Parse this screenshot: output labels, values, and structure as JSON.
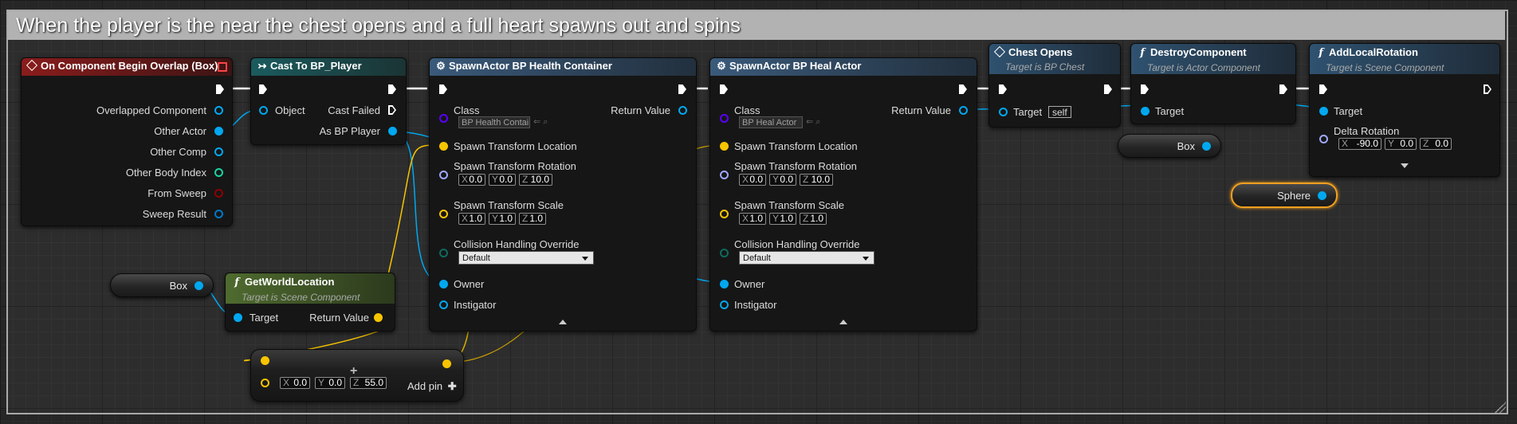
{
  "comment": {
    "title": "When the player is the near the chest opens and a full heart spawns out and spins"
  },
  "colors": {
    "exec": "#ffffff",
    "object": "#00a8f0",
    "struct": "#f7c400",
    "rotator": "#9fa8ff",
    "class": "#5a00ff",
    "boolean": "#8d0000",
    "hitresult": "#00a8f0",
    "enum": "#0e6b5f",
    "selection": "#f2a020"
  },
  "nodes": {
    "overlap": {
      "title": "On Component Begin Overlap (Box)",
      "pins": [
        "Overlapped Component",
        "Other Actor",
        "Other Comp",
        "Other Body Index",
        "From Sweep",
        "Sweep Result"
      ]
    },
    "cast": {
      "title": "Cast To BP_Player",
      "object_label": "Object",
      "cast_failed_label": "Cast Failed",
      "as_player_label": "As BP Player"
    },
    "spawn_health": {
      "title": "SpawnActor BP Health Container",
      "class_label": "Class",
      "class_value": "BP Health Contai",
      "return_label": "Return Value",
      "location_label": "Spawn Transform Location",
      "rotation_label": "Spawn Transform Rotation",
      "rotation": {
        "x": "0.0",
        "y": "0.0",
        "z": "10.0"
      },
      "scale_label": "Spawn Transform Scale",
      "scale": {
        "x": "1.0",
        "y": "1.0",
        "z": "1.0"
      },
      "collision_label": "Collision Handling Override",
      "collision_value": "Default",
      "owner_label": "Owner",
      "instigator_label": "Instigator"
    },
    "spawn_heal": {
      "title": "SpawnActor BP Heal Actor",
      "class_label": "Class",
      "class_value": "BP Heal Actor",
      "return_label": "Return Value",
      "location_label": "Spawn Transform Location",
      "rotation_label": "Spawn Transform Rotation",
      "rotation": {
        "x": "0.0",
        "y": "0.0",
        "z": "10.0"
      },
      "scale_label": "Spawn Transform Scale",
      "scale": {
        "x": "1.0",
        "y": "1.0",
        "z": "1.0"
      },
      "collision_label": "Collision Handling Override",
      "collision_value": "Default",
      "owner_label": "Owner",
      "instigator_label": "Instigator"
    },
    "chest_opens": {
      "title": "Chest Opens",
      "subtitle": "Target is BP Chest",
      "target_label": "Target",
      "target_value": "self"
    },
    "destroy": {
      "title": "DestroyComponent",
      "subtitle": "Target is Actor Component",
      "target_label": "Target"
    },
    "add_rotation": {
      "title": "AddLocalRotation",
      "subtitle": "Target is Scene Component",
      "target_label": "Target",
      "delta_label": "Delta Rotation",
      "delta": {
        "x": "-90.0",
        "y": "0.0",
        "z": "0.0"
      }
    },
    "get_world_location": {
      "title": "GetWorldLocation",
      "subtitle": "Target is Scene Component",
      "target_label": "Target",
      "return_label": "Return Value"
    },
    "add_vector": {
      "vec": {
        "x": "0.0",
        "y": "0.0",
        "z": "55.0"
      },
      "add_pin_label": "Add pin"
    },
    "var_box_1": {
      "label": "Box"
    },
    "var_box_2": {
      "label": "Box"
    },
    "var_sphere": {
      "label": "Sphere"
    }
  },
  "axis_labels": {
    "x": "X",
    "y": "Y",
    "z": "Z"
  }
}
